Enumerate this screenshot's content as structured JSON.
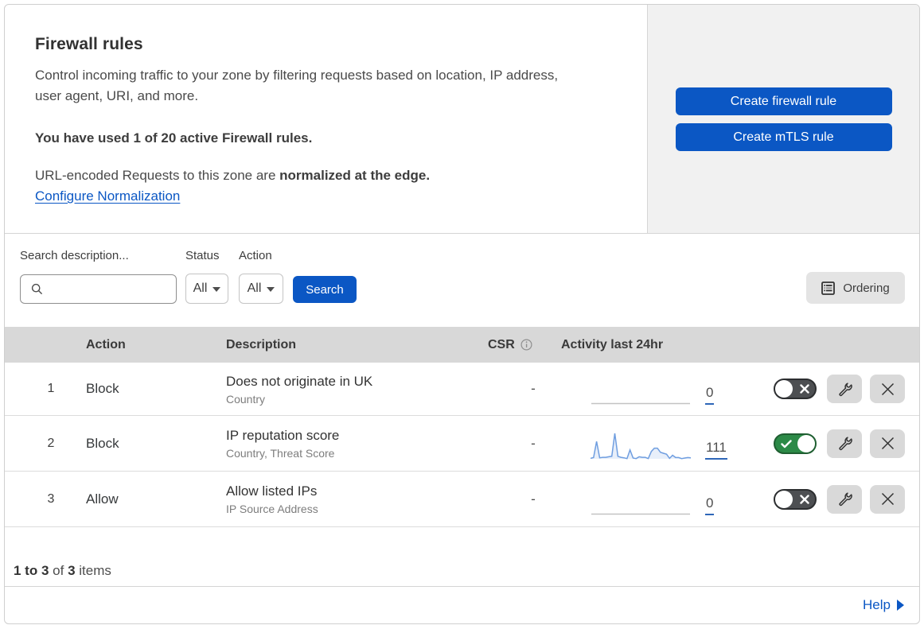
{
  "header": {
    "title": "Firewall rules",
    "description": "Control incoming traffic to your zone by filtering requests based on location, IP address, user agent, URI, and more.",
    "usage": "You have used 1 of 20 active Firewall rules.",
    "normalization_text": "URL-encoded Requests to this zone are",
    "normalization_bold": "normalized at the edge.",
    "normalization_link": "Configure Normalization",
    "buttons": {
      "create_firewall_rule": "Create firewall rule",
      "create_mtls_rule": "Create mTLS rule"
    }
  },
  "toolbar": {
    "search_label": "Search description...",
    "search_value": "",
    "status_label": "Status",
    "status_value": "All",
    "action_label": "Action",
    "action_value": "All",
    "search_button": "Search",
    "ordering_button": "Ordering"
  },
  "table": {
    "columns": {
      "action": "Action",
      "description": "Description",
      "csr": "CSR",
      "activity": "Activity last 24hr"
    },
    "rows": [
      {
        "index": "1",
        "action": "Block",
        "description": "Does not originate in UK",
        "fields": "Country",
        "csr": "-",
        "activity_count": "0",
        "enabled": false
      },
      {
        "index": "2",
        "action": "Block",
        "description": "IP reputation score",
        "fields": "Country, Threat Score",
        "csr": "-",
        "activity_count": "111",
        "enabled": true
      },
      {
        "index": "3",
        "action": "Allow",
        "description": "Allow listed IPs",
        "fields": "IP Source Address",
        "csr": "-",
        "activity_count": "0",
        "enabled": false
      }
    ]
  },
  "chart_data": {
    "type": "area",
    "title": "Activity last 24hr sparkline (rule 2)",
    "x": [
      0,
      1,
      2,
      3,
      4,
      5,
      6,
      7,
      8,
      9,
      10,
      11,
      12,
      13,
      14,
      15,
      16,
      17,
      18,
      19,
      20,
      21,
      22,
      23,
      24,
      25,
      26,
      27,
      28,
      29,
      30,
      31,
      32,
      33
    ],
    "values": [
      2,
      5,
      68,
      4,
      6,
      6,
      8,
      10,
      100,
      10,
      6,
      4,
      1,
      35,
      3,
      1,
      8,
      6,
      6,
      1,
      29,
      42,
      42,
      26,
      22,
      18,
      2,
      14,
      5,
      5,
      1,
      3,
      5,
      4
    ],
    "total": 111,
    "line_color": "#6f9ee0",
    "fill_color": "rgba(111,158,224,0.16)"
  },
  "footer": {
    "range": "1 to 3",
    "of": "of",
    "total": "3",
    "items_label": "items",
    "help": "Help"
  }
}
